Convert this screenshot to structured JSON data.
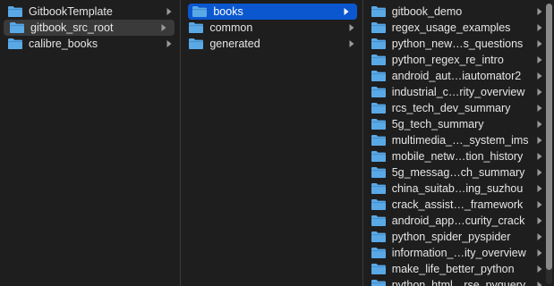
{
  "colors": {
    "background": "#1e1e1e",
    "folder": "#5aa9e6",
    "selection_active": "#0b57d0",
    "selection_inactive": "#3a3a3a",
    "text": "#e6e6e6",
    "chevron": "#9a9a9a"
  },
  "columns": [
    {
      "items": [
        {
          "label": "GitbookTemplate",
          "icon": "folder-icon",
          "state": "normal"
        },
        {
          "label": "gitbook_src_root",
          "icon": "folder-icon",
          "state": "selected-inactive"
        },
        {
          "label": "calibre_books",
          "icon": "folder-icon",
          "state": "normal"
        }
      ]
    },
    {
      "items": [
        {
          "label": "books",
          "icon": "folder-icon",
          "state": "selected-active"
        },
        {
          "label": "common",
          "icon": "folder-icon",
          "state": "normal"
        },
        {
          "label": "generated",
          "icon": "folder-icon",
          "state": "normal"
        }
      ]
    },
    {
      "items": [
        {
          "label": "gitbook_demo",
          "icon": "folder-icon",
          "state": "normal"
        },
        {
          "label": "regex_usage_examples",
          "icon": "folder-icon",
          "state": "normal"
        },
        {
          "label": "python_new…s_questions",
          "icon": "folder-icon",
          "state": "normal"
        },
        {
          "label": "python_regex_re_intro",
          "icon": "folder-icon",
          "state": "normal"
        },
        {
          "label": "android_aut…iautomator2",
          "icon": "folder-icon",
          "state": "normal"
        },
        {
          "label": "industrial_c…rity_overview",
          "icon": "folder-icon",
          "state": "normal"
        },
        {
          "label": "rcs_tech_dev_summary",
          "icon": "folder-icon",
          "state": "normal"
        },
        {
          "label": "5g_tech_summary",
          "icon": "folder-icon",
          "state": "normal"
        },
        {
          "label": "multimedia_…_system_ims",
          "icon": "folder-icon",
          "state": "normal"
        },
        {
          "label": "mobile_netw…tion_history",
          "icon": "folder-icon",
          "state": "normal"
        },
        {
          "label": "5g_messag…ch_summary",
          "icon": "folder-icon",
          "state": "normal"
        },
        {
          "label": "china_suitab…ing_suzhou",
          "icon": "folder-icon",
          "state": "normal"
        },
        {
          "label": "crack_assist…_framework",
          "icon": "folder-icon",
          "state": "normal"
        },
        {
          "label": "android_app…curity_crack",
          "icon": "folder-icon",
          "state": "normal"
        },
        {
          "label": "python_spider_pyspider",
          "icon": "folder-icon",
          "state": "normal"
        },
        {
          "label": "information_…ity_overview",
          "icon": "folder-icon",
          "state": "normal"
        },
        {
          "label": "make_life_better_python",
          "icon": "folder-icon",
          "state": "normal"
        },
        {
          "label": "python_html…rse_pyquery",
          "icon": "folder-icon",
          "state": "normal"
        }
      ],
      "scroll_visible_fraction": 0.95
    }
  ]
}
